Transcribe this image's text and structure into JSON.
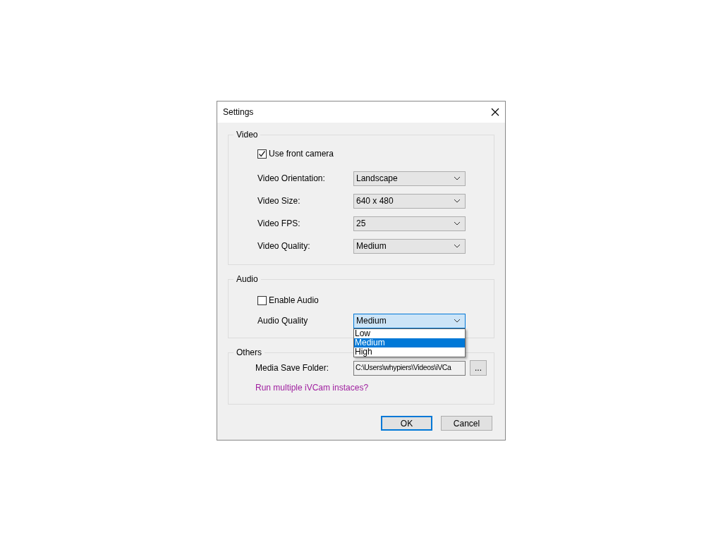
{
  "window": {
    "title": "Settings"
  },
  "groups": [
    {
      "title": "Video",
      "items": [
        {
          "kind": "checkbox",
          "label": "Use front camera",
          "checked": true
        },
        {
          "kind": "select",
          "label": "Video Orientation:",
          "value": "Landscape",
          "expanded": false
        },
        {
          "kind": "select",
          "label": "Video Size:",
          "value": "640 x 480",
          "expanded": false
        },
        {
          "kind": "select",
          "label": "Video FPS:",
          "value": "25",
          "expanded": false
        },
        {
          "kind": "select",
          "label": "Video Quality:",
          "value": "Medium",
          "expanded": false
        }
      ]
    },
    {
      "title": "Audio",
      "items": [
        {
          "kind": "checkbox",
          "label": "Enable Audio",
          "checked": false
        },
        {
          "kind": "select",
          "label": "Audio Quality",
          "value": "Medium",
          "expanded": true,
          "options": [
            {
              "label": "Low",
              "selected": false
            },
            {
              "label": "Medium",
              "selected": true
            },
            {
              "label": "High",
              "selected": false
            }
          ]
        }
      ]
    },
    {
      "title": "Others",
      "items": [
        {
          "kind": "path",
          "label": "Media Save Folder:",
          "value": "C:\\Users\\whypiers\\Videos\\iVCa",
          "button": "..."
        },
        {
          "kind": "link",
          "label": "Run multiple iVCam instaces?"
        }
      ]
    }
  ],
  "buttons": [
    {
      "label": "OK",
      "default": true
    },
    {
      "label": "Cancel",
      "default": false
    }
  ]
}
